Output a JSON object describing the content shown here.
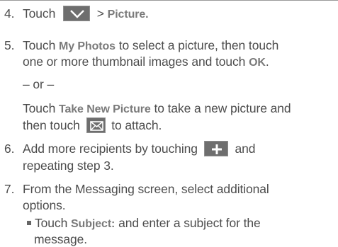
{
  "colors": {
    "text": "#4d4d4d",
    "bold_text": "#7a7a7a",
    "icon_fill": "#6e6e6e",
    "rule": "#9a9a9a"
  },
  "steps": {
    "s4": {
      "num": "4.",
      "pre": "Touch",
      "icon": "chevron-down-icon",
      "gt": ">",
      "picture": "Picture."
    },
    "s5": {
      "num": "5.",
      "l1_pre": "Touch",
      "my_photos": "My Photos",
      "l1_post": "to select a picture, then touch",
      "l2_pre": "one or more thumbnail images and touch",
      "ok": "OK",
      "l2_post": ".",
      "or": "– or –",
      "l3_pre": "Touch",
      "take_new_picture": "Take New Picture",
      "l3_post": "to take a new picture and",
      "l4_pre": "then touch",
      "attach_icon": "envelope-icon",
      "l4_post": "to attach."
    },
    "s6": {
      "num": "6.",
      "l1_pre": "Add more recipients by touching",
      "icon": "plus-icon",
      "l1_post": "and",
      "l2": "repeating step 3."
    },
    "s7": {
      "num": "7.",
      "l1": "From the Messaging screen, select additional",
      "l2": "options.",
      "bullet_pre": "Touch",
      "subject": "Subject:",
      "bullet_post": "and enter a subject for the",
      "bullet_l2": "message."
    }
  }
}
